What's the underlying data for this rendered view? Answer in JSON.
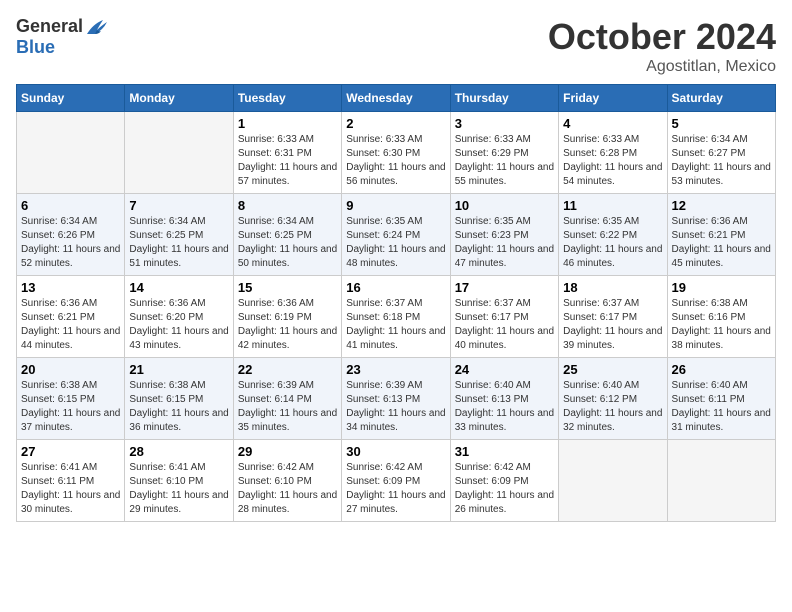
{
  "header": {
    "logo_general": "General",
    "logo_blue": "Blue",
    "month_title": "October 2024",
    "location": "Agostitlan, Mexico"
  },
  "days_of_week": [
    "Sunday",
    "Monday",
    "Tuesday",
    "Wednesday",
    "Thursday",
    "Friday",
    "Saturday"
  ],
  "weeks": [
    [
      {
        "day": "",
        "sunrise": "",
        "sunset": "",
        "daylight": ""
      },
      {
        "day": "",
        "sunrise": "",
        "sunset": "",
        "daylight": ""
      },
      {
        "day": "1",
        "sunrise": "Sunrise: 6:33 AM",
        "sunset": "Sunset: 6:31 PM",
        "daylight": "Daylight: 11 hours and 57 minutes."
      },
      {
        "day": "2",
        "sunrise": "Sunrise: 6:33 AM",
        "sunset": "Sunset: 6:30 PM",
        "daylight": "Daylight: 11 hours and 56 minutes."
      },
      {
        "day": "3",
        "sunrise": "Sunrise: 6:33 AM",
        "sunset": "Sunset: 6:29 PM",
        "daylight": "Daylight: 11 hours and 55 minutes."
      },
      {
        "day": "4",
        "sunrise": "Sunrise: 6:33 AM",
        "sunset": "Sunset: 6:28 PM",
        "daylight": "Daylight: 11 hours and 54 minutes."
      },
      {
        "day": "5",
        "sunrise": "Sunrise: 6:34 AM",
        "sunset": "Sunset: 6:27 PM",
        "daylight": "Daylight: 11 hours and 53 minutes."
      }
    ],
    [
      {
        "day": "6",
        "sunrise": "Sunrise: 6:34 AM",
        "sunset": "Sunset: 6:26 PM",
        "daylight": "Daylight: 11 hours and 52 minutes."
      },
      {
        "day": "7",
        "sunrise": "Sunrise: 6:34 AM",
        "sunset": "Sunset: 6:25 PM",
        "daylight": "Daylight: 11 hours and 51 minutes."
      },
      {
        "day": "8",
        "sunrise": "Sunrise: 6:34 AM",
        "sunset": "Sunset: 6:25 PM",
        "daylight": "Daylight: 11 hours and 50 minutes."
      },
      {
        "day": "9",
        "sunrise": "Sunrise: 6:35 AM",
        "sunset": "Sunset: 6:24 PM",
        "daylight": "Daylight: 11 hours and 48 minutes."
      },
      {
        "day": "10",
        "sunrise": "Sunrise: 6:35 AM",
        "sunset": "Sunset: 6:23 PM",
        "daylight": "Daylight: 11 hours and 47 minutes."
      },
      {
        "day": "11",
        "sunrise": "Sunrise: 6:35 AM",
        "sunset": "Sunset: 6:22 PM",
        "daylight": "Daylight: 11 hours and 46 minutes."
      },
      {
        "day": "12",
        "sunrise": "Sunrise: 6:36 AM",
        "sunset": "Sunset: 6:21 PM",
        "daylight": "Daylight: 11 hours and 45 minutes."
      }
    ],
    [
      {
        "day": "13",
        "sunrise": "Sunrise: 6:36 AM",
        "sunset": "Sunset: 6:21 PM",
        "daylight": "Daylight: 11 hours and 44 minutes."
      },
      {
        "day": "14",
        "sunrise": "Sunrise: 6:36 AM",
        "sunset": "Sunset: 6:20 PM",
        "daylight": "Daylight: 11 hours and 43 minutes."
      },
      {
        "day": "15",
        "sunrise": "Sunrise: 6:36 AM",
        "sunset": "Sunset: 6:19 PM",
        "daylight": "Daylight: 11 hours and 42 minutes."
      },
      {
        "day": "16",
        "sunrise": "Sunrise: 6:37 AM",
        "sunset": "Sunset: 6:18 PM",
        "daylight": "Daylight: 11 hours and 41 minutes."
      },
      {
        "day": "17",
        "sunrise": "Sunrise: 6:37 AM",
        "sunset": "Sunset: 6:17 PM",
        "daylight": "Daylight: 11 hours and 40 minutes."
      },
      {
        "day": "18",
        "sunrise": "Sunrise: 6:37 AM",
        "sunset": "Sunset: 6:17 PM",
        "daylight": "Daylight: 11 hours and 39 minutes."
      },
      {
        "day": "19",
        "sunrise": "Sunrise: 6:38 AM",
        "sunset": "Sunset: 6:16 PM",
        "daylight": "Daylight: 11 hours and 38 minutes."
      }
    ],
    [
      {
        "day": "20",
        "sunrise": "Sunrise: 6:38 AM",
        "sunset": "Sunset: 6:15 PM",
        "daylight": "Daylight: 11 hours and 37 minutes."
      },
      {
        "day": "21",
        "sunrise": "Sunrise: 6:38 AM",
        "sunset": "Sunset: 6:15 PM",
        "daylight": "Daylight: 11 hours and 36 minutes."
      },
      {
        "day": "22",
        "sunrise": "Sunrise: 6:39 AM",
        "sunset": "Sunset: 6:14 PM",
        "daylight": "Daylight: 11 hours and 35 minutes."
      },
      {
        "day": "23",
        "sunrise": "Sunrise: 6:39 AM",
        "sunset": "Sunset: 6:13 PM",
        "daylight": "Daylight: 11 hours and 34 minutes."
      },
      {
        "day": "24",
        "sunrise": "Sunrise: 6:40 AM",
        "sunset": "Sunset: 6:13 PM",
        "daylight": "Daylight: 11 hours and 33 minutes."
      },
      {
        "day": "25",
        "sunrise": "Sunrise: 6:40 AM",
        "sunset": "Sunset: 6:12 PM",
        "daylight": "Daylight: 11 hours and 32 minutes."
      },
      {
        "day": "26",
        "sunrise": "Sunrise: 6:40 AM",
        "sunset": "Sunset: 6:11 PM",
        "daylight": "Daylight: 11 hours and 31 minutes."
      }
    ],
    [
      {
        "day": "27",
        "sunrise": "Sunrise: 6:41 AM",
        "sunset": "Sunset: 6:11 PM",
        "daylight": "Daylight: 11 hours and 30 minutes."
      },
      {
        "day": "28",
        "sunrise": "Sunrise: 6:41 AM",
        "sunset": "Sunset: 6:10 PM",
        "daylight": "Daylight: 11 hours and 29 minutes."
      },
      {
        "day": "29",
        "sunrise": "Sunrise: 6:42 AM",
        "sunset": "Sunset: 6:10 PM",
        "daylight": "Daylight: 11 hours and 28 minutes."
      },
      {
        "day": "30",
        "sunrise": "Sunrise: 6:42 AM",
        "sunset": "Sunset: 6:09 PM",
        "daylight": "Daylight: 11 hours and 27 minutes."
      },
      {
        "day": "31",
        "sunrise": "Sunrise: 6:42 AM",
        "sunset": "Sunset: 6:09 PM",
        "daylight": "Daylight: 11 hours and 26 minutes."
      },
      {
        "day": "",
        "sunrise": "",
        "sunset": "",
        "daylight": ""
      },
      {
        "day": "",
        "sunrise": "",
        "sunset": "",
        "daylight": ""
      }
    ]
  ]
}
